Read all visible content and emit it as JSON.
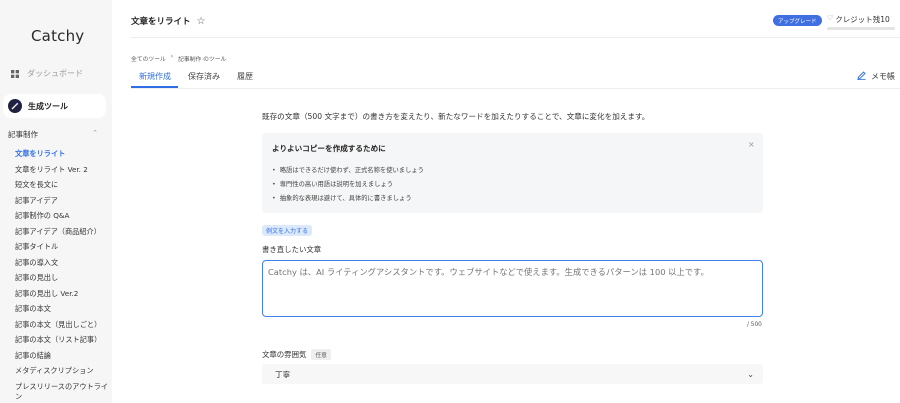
{
  "app": {
    "logo": "Catchy"
  },
  "sidebar": {
    "dashboard": "ダッシュボード",
    "generate_tools": "生成ツール",
    "category": "記事制作",
    "items": [
      {
        "label": "文章をリライト",
        "active": true
      },
      {
        "label": "文章をリライト Ver. 2"
      },
      {
        "label": "短文を長文に"
      },
      {
        "label": "記事アイデア"
      },
      {
        "label": "記事制作の Q&A"
      },
      {
        "label": "記事アイデア（商品紹介）"
      },
      {
        "label": "記事タイトル"
      },
      {
        "label": "記事の導入文"
      },
      {
        "label": "記事の見出し"
      },
      {
        "label": "記事の見出し Ver.2"
      },
      {
        "label": "記事の本文"
      },
      {
        "label": "記事の本文（見出しごと）"
      },
      {
        "label": "記事の本文（リスト記事）"
      },
      {
        "label": "記事の結論"
      },
      {
        "label": "メタディスクリプション"
      },
      {
        "label": "プレスリリースのアウトライン"
      }
    ]
  },
  "header": {
    "title": "文章をリライト",
    "upgrade": "アップグレード",
    "credit": "クレジット残10"
  },
  "breadcrumb": {
    "root": "全てのツール",
    "sep": "›",
    "current": "記事制作 のツール"
  },
  "tabs": [
    {
      "label": "新規作成",
      "active": true
    },
    {
      "label": "保存済み"
    },
    {
      "label": "履歴"
    }
  ],
  "memo": "メモ帳",
  "main": {
    "intro": "既存の文章（500 文字まで）の書き方を変えたり、新たなワードを加えたりすることで、文章に変化を加えます。",
    "tips": {
      "title": "よりよいコピーを作成するために",
      "close": "×",
      "items": [
        "略語はできるだけ使わず、正式名称を使いましょう",
        "専門性の高い用語は説明を加えましょう",
        "抽象的な表現は避けて、具体的に書きましょう"
      ]
    },
    "example_button": "例文を入力する",
    "rewrite_label": "書き直したい文章",
    "rewrite_placeholder": "Catchy は、AI ライティングアシスタントです。ウェブサイトなどで使えます。生成できるパターンは 100 以上です。",
    "counter": "/ 500",
    "tone_label": "文章の雰囲気",
    "tone_optional": "任意",
    "tone_value": "丁寧"
  },
  "colors": {
    "accent": "#2f6fe4",
    "upgrade": "#3f6fe0"
  }
}
